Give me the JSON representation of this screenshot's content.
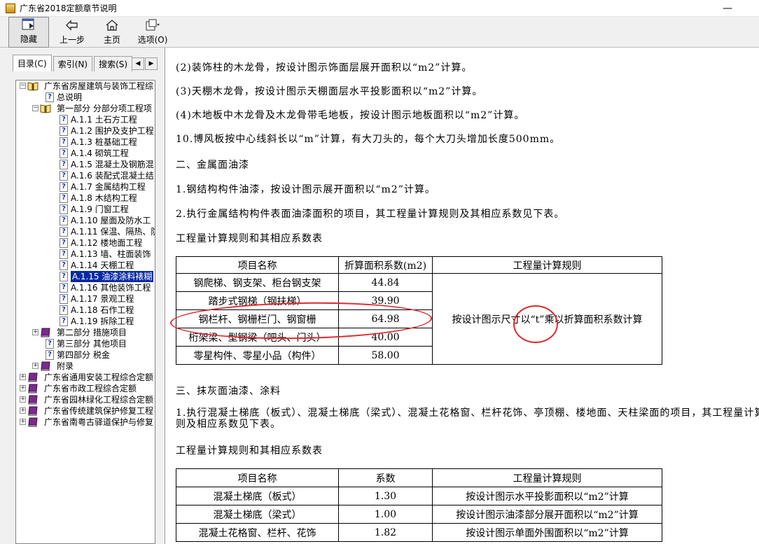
{
  "window": {
    "title": "广东省2018定额章节说明"
  },
  "toolbar": {
    "hide": "隐藏",
    "back": "上一步",
    "home": "主页",
    "options": "选项(O)"
  },
  "tabs": [
    "目录(C)",
    "索引(N)",
    "搜索(S)"
  ],
  "tree": [
    {
      "label": "广东省房屋建筑与装饰工程综",
      "icon": "book-open-icon",
      "toggle": "−",
      "level": 0
    },
    {
      "label": "总说明",
      "icon": "help-page-icon",
      "level": 1
    },
    {
      "label": "第一部分 分部分项工程项",
      "icon": "book-open-icon",
      "toggle": "−",
      "level": 1
    },
    {
      "label": "A.1.1 土石方工程",
      "icon": "help-page-icon",
      "level": 2
    },
    {
      "label": "A.1.2 围护及支护工程",
      "icon": "help-page-icon",
      "level": 2
    },
    {
      "label": "A.1.3 桩基础工程",
      "icon": "help-page-icon",
      "level": 2
    },
    {
      "label": "A.1.4 砌筑工程",
      "icon": "help-page-icon",
      "level": 2
    },
    {
      "label": "A.1.5 混凝土及钢筋混",
      "icon": "help-page-icon",
      "level": 2
    },
    {
      "label": "A.1.6 装配式混凝土结",
      "icon": "help-page-icon",
      "level": 2
    },
    {
      "label": "A.1.7 金属结构工程",
      "icon": "help-page-icon",
      "level": 2
    },
    {
      "label": "A.1.8 木结构工程",
      "icon": "help-page-icon",
      "level": 2
    },
    {
      "label": "A.1.9 门窗工程",
      "icon": "help-page-icon",
      "level": 2
    },
    {
      "label": "A.1.10 屋面及防水工",
      "icon": "help-page-icon",
      "level": 2
    },
    {
      "label": "A.1.11 保温、隔热、防",
      "icon": "help-page-icon",
      "level": 2
    },
    {
      "label": "A.1.12 楼地面工程",
      "icon": "help-page-icon",
      "level": 2
    },
    {
      "label": "A.1.13 墙、柱面装饰",
      "icon": "help-page-icon",
      "level": 2
    },
    {
      "label": "A.1.14 天棚工程",
      "icon": "help-page-icon",
      "level": 2
    },
    {
      "label": "A.1.15 油漆涂料裱糊",
      "icon": "help-page-icon",
      "level": 2,
      "selected": true
    },
    {
      "label": "A.1.16 其他装饰工程",
      "icon": "help-page-icon",
      "level": 2
    },
    {
      "label": "A.1.17 景观工程",
      "icon": "help-page-icon",
      "level": 2
    },
    {
      "label": "A.1.18 石作工程",
      "icon": "help-page-icon",
      "level": 2
    },
    {
      "label": "A.1.19 拆除工程",
      "icon": "help-page-icon",
      "level": 2
    },
    {
      "label": "第二部分 措施项目",
      "icon": "book-closed-icon",
      "toggle": "+",
      "level": 1
    },
    {
      "label": "第三部分 其他项目",
      "icon": "help-page-icon",
      "level": 1
    },
    {
      "label": "第四部分 税金",
      "icon": "help-page-icon",
      "level": 1
    },
    {
      "label": "附录",
      "icon": "book-closed-icon",
      "toggle": "+",
      "level": 1
    },
    {
      "label": "广东省通用安装工程综合定额",
      "icon": "book-closed-icon",
      "toggle": "+",
      "level": 0
    },
    {
      "label": "广东省市政工程综合定额",
      "icon": "book-closed-icon",
      "toggle": "+",
      "level": 0
    },
    {
      "label": "广东省园林绿化工程综合定额",
      "icon": "book-closed-icon",
      "toggle": "+",
      "level": 0
    },
    {
      "label": "广东省传统建筑保护修复工程",
      "icon": "book-closed-icon",
      "toggle": "+",
      "level": 0
    },
    {
      "label": "广东省南粤古驿道保护与修复",
      "icon": "book-closed-icon",
      "toggle": "+",
      "level": 0
    }
  ],
  "content": {
    "lines": [
      "(2)装饰柱的木龙骨，按设计图示饰面层展开面积以“m2”计算。",
      "(3)天棚木龙骨，按设计图示天棚面层水平投影面积以“m2”计算。",
      "(4)木地板中木龙骨及木龙骨带毛地板，按设计图示地板面积以“m2”计算。",
      "10.博风板按中心线斜长以“m”计算，有大刀头的，每个大刀头增加长度500mm。",
      "二、金属面油漆",
      "1.钢结构构件油漆，按设计图示展开面积以“m2”计算。",
      "2.执行金属结构构件表面油漆面积的项目，其工程量计算规则及其相应系数见下表。",
      "工程量计算规则和其相应系数表"
    ],
    "table1": {
      "headers": [
        "项目名称",
        "折算面积系数(m2)",
        "工程量计算规则"
      ],
      "rows": [
        [
          "钢爬梯、钢支架、柜台钢支架",
          "44.84"
        ],
        [
          "踏步式钢梯（钢扶梯）",
          "39.90"
        ],
        [
          "钢栏杆、钢栅栏门、钢窗栅",
          "64.98"
        ],
        [
          "桁架梁、型钢梁（吧头、门头）",
          "40.00"
        ],
        [
          "零星构件、零星小品（构件）",
          "58.00"
        ]
      ],
      "rule": "按设计图示尺寸以“t”乘以折算面积系数计算"
    },
    "section3": "三、抹灰面油漆、涂料",
    "section3_para": "1.执行混凝土梯底（板式）、混凝土梯底（梁式）、混凝土花格窗、栏杆花饰、亭顶棚、楼地面、天柱梁面的项目，其工程量计算规则及相应系数见下表。",
    "table2_title": "工程量计算规则和其相应系数表",
    "table2": {
      "headers": [
        "项目名称",
        "系数",
        "工程量计算规则"
      ],
      "rows": [
        [
          "混凝土梯底（板式）",
          "1.30",
          "按设计图示水平投影面积以“m2”计算"
        ],
        [
          "混凝土梯底（梁式）",
          "1.00",
          "按设计图示油漆部分展开面积以“m2”计算"
        ],
        [
          "混凝土花格窗、栏杆、花饰",
          "1.82",
          "按设计图示单面外围面积以“m2”计算"
        ]
      ]
    }
  },
  "colors": {
    "annotation": "#e0292e",
    "selection": "#0a2aa0"
  }
}
